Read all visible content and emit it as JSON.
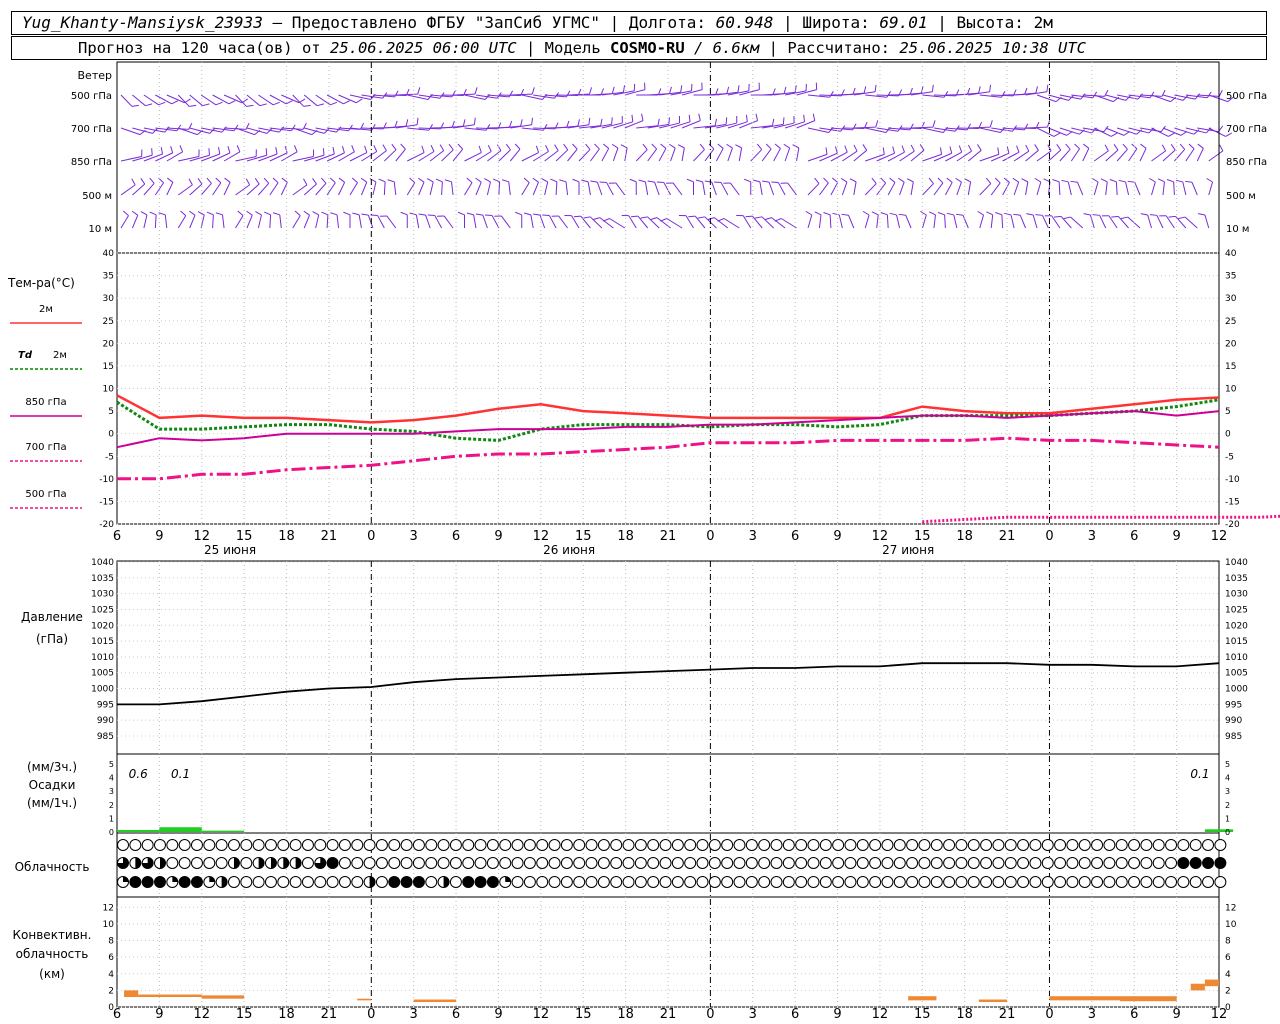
{
  "header": {
    "line1": {
      "station": "Yug_Khanty-Mansiysk_23933",
      "provider": "— Предоставлено ФГБУ \"ЗапСиб УГМС\"",
      "lon_label": "Долгота:",
      "lon_value": "60.948",
      "lat_label": "Широта:",
      "lat_value": "69.01",
      "alt_label": "Высота: 2м",
      "sep": "|"
    },
    "line2": {
      "forecast_label": "Прогноз на 120 часа(ов) от",
      "forecast_time": "25.06.2025 06:00 UTC",
      "model_label": "Модель",
      "model_name": "COSMO-RU",
      "model_res": "/ 6.6км",
      "calc_label": "Рассчитано:",
      "calc_time": "25.06.2025 10:38 UTC",
      "sep": "|"
    }
  },
  "wind_panel": {
    "title": "Ветер",
    "levels": [
      "500 гПа",
      "700 гПа",
      "850 гПа",
      "500 м",
      "10 м"
    ]
  },
  "temp_panel": {
    "title": "Тем-ра(°C)",
    "legend": [
      {
        "label": "2м",
        "color": "#ff3333"
      },
      {
        "label_italic": "Td",
        "label": "2м",
        "color": "#008800"
      },
      {
        "label": "850 гПа",
        "color": "#cc0099"
      },
      {
        "label": "700 гПа",
        "color": "#ee1188"
      },
      {
        "label": "500 гПа",
        "color": "#ee1188"
      }
    ],
    "yticks": [
      40,
      35,
      30,
      25,
      20,
      15,
      10,
      5,
      0,
      -5,
      -10,
      -15,
      -20
    ]
  },
  "pressure_panel": {
    "title": "Давление",
    "unit": "(гПа)",
    "yticks": [
      1040,
      1035,
      1030,
      1025,
      1020,
      1015,
      1010,
      1005,
      1000,
      995,
      990,
      985
    ]
  },
  "precip_panel": {
    "unit3": "(мм/3ч.)",
    "title": "Осадки",
    "unit1": "(мм/1ч.)",
    "yticks": [
      5,
      4,
      3,
      2,
      1,
      0
    ],
    "annotations": [
      "0.6",
      "0.1",
      "0.1"
    ],
    "color": "#22cc22"
  },
  "cloud_panel": {
    "title": "Облачность"
  },
  "conv_panel": {
    "title1": "Конвективн.",
    "title2": "облачность",
    "unit": "(км)",
    "yticks": [
      12,
      10,
      8,
      6,
      4,
      2,
      0
    ],
    "color": "#ee8833"
  },
  "x_axis": {
    "hour_labels": [
      "6",
      "9",
      "12",
      "15",
      "18",
      "21",
      "0",
      "3",
      "6",
      "9",
      "12",
      "15",
      "18",
      "21",
      "0",
      "3",
      "6",
      "9",
      "12",
      "15",
      "18",
      "21",
      "0",
      "3",
      "6",
      "9",
      "12"
    ],
    "day_labels": [
      "25 июня",
      "26 июня",
      "27 июня"
    ]
  },
  "chart_data": {
    "type": "line",
    "x_hours": [
      0,
      3,
      6,
      9,
      12,
      15,
      18,
      21,
      24,
      27,
      30,
      33,
      36,
      39,
      42,
      45,
      48,
      51,
      54,
      57,
      60,
      63,
      66,
      69,
      72,
      75,
      78
    ],
    "temperature": {
      "ylim": [
        -20,
        40
      ],
      "series": [
        {
          "name": "2м",
          "values": [
            8.5,
            3.5,
            4,
            3.5,
            3.5,
            3,
            2.5,
            3,
            4,
            5.5,
            6.5,
            5,
            4.5,
            4,
            3.5,
            3.5,
            3.5,
            3.5,
            3.5,
            6,
            5,
            4.5,
            4.5,
            5.5,
            6.5,
            7.5,
            8
          ]
        },
        {
          "name": "Td 2м",
          "values": [
            7,
            1,
            1,
            1.5,
            2,
            2,
            1,
            0.5,
            -1,
            -1.5,
            1,
            2,
            2,
            2,
            1.5,
            2,
            2,
            1.5,
            2,
            4,
            4,
            4,
            4,
            4.5,
            5,
            6,
            7.5
          ]
        },
        {
          "name": "850 гПа",
          "values": [
            -3,
            -1,
            -1.5,
            -1,
            0,
            0,
            0,
            0,
            0.5,
            1,
            1,
            1,
            1.5,
            1.5,
            2,
            2,
            2.5,
            3,
            3.5,
            4,
            4,
            3.5,
            4,
            4.5,
            5,
            4,
            5
          ]
        },
        {
          "name": "700 гПа",
          "values": [
            -10,
            -10,
            -9,
            -9,
            -8,
            -7.5,
            -7,
            -6,
            -5,
            -4.5,
            -4.5,
            -4,
            -3.5,
            -3,
            -2,
            -2,
            -2,
            -1.5,
            -1.5,
            -1.5,
            -1.5,
            -1,
            -1.5,
            -1.5,
            -2,
            -2.5,
            -3
          ]
        },
        {
          "name": "500 гПа",
          "x_start": 57,
          "values": [
            -19.5,
            -19,
            -18.5,
            -18.5,
            -18.5,
            -18.5,
            -18.5,
            -18.5,
            -18.5,
            -18,
            -18,
            -18.5,
            -19,
            -19,
            -19.5
          ]
        }
      ]
    },
    "pressure": {
      "ylim": [
        985,
        1040
      ],
      "values": [
        995,
        995,
        996,
        997.5,
        999,
        1000,
        1000.5,
        1002,
        1003,
        1003.5,
        1004,
        1004.5,
        1005,
        1005.5,
        1006,
        1006.5,
        1006.5,
        1007,
        1007,
        1008,
        1008,
        1008,
        1007.5,
        1007.5,
        1007,
        1007,
        1008
      ]
    },
    "precipitation": {
      "ylim": [
        0,
        5
      ],
      "bars": [
        {
          "x": 0,
          "w": 3,
          "v": 0.15
        },
        {
          "x": 3,
          "w": 3,
          "v": 0.35
        },
        {
          "x": 6,
          "w": 3,
          "v": 0.1
        },
        {
          "x": 77,
          "w": 2,
          "v": 0.2
        }
      ]
    },
    "cloud_rows": {
      "row1": [
        0,
        0,
        0,
        0,
        0,
        0,
        0,
        0,
        0,
        0,
        0,
        0,
        0,
        0,
        0,
        0,
        0,
        0,
        0,
        0,
        0,
        0,
        0,
        0,
        0,
        0,
        0,
        0,
        0,
        0,
        0,
        0,
        0,
        0,
        0,
        0,
        0,
        0,
        0,
        0,
        0,
        0,
        0,
        0,
        0,
        0,
        0,
        0,
        0,
        0,
        0,
        0,
        0,
        0,
        0,
        0,
        0,
        0,
        0,
        0,
        0,
        0,
        0,
        0,
        0,
        0,
        0,
        0,
        0,
        0,
        0,
        0,
        0,
        0,
        0,
        0,
        0,
        0,
        0,
        0,
        0,
        0,
        0,
        0,
        0,
        0,
        0,
        0,
        0,
        0
      ],
      "row2": [
        3,
        2,
        3,
        2,
        0,
        0,
        0,
        0,
        0,
        2,
        0,
        2,
        2,
        2,
        2,
        0,
        3,
        4,
        0,
        0,
        0,
        0,
        0,
        0,
        0,
        0,
        0,
        0,
        0,
        0,
        0,
        0,
        0,
        0,
        0,
        0,
        0,
        0,
        0,
        0,
        0,
        0,
        0,
        0,
        0,
        0,
        0,
        0,
        0,
        0,
        0,
        0,
        0,
        0,
        0,
        0,
        0,
        0,
        0,
        0,
        0,
        0,
        0,
        0,
        0,
        0,
        0,
        0,
        0,
        0,
        0,
        0,
        0,
        0,
        0,
        0,
        0,
        0,
        0,
        0,
        0,
        0,
        0,
        0,
        0,
        0,
        4,
        4,
        4,
        4
      ],
      "row3": [
        1,
        4,
        4,
        4,
        1,
        4,
        4,
        1,
        2,
        0,
        0,
        0,
        0,
        0,
        0,
        0,
        0,
        0,
        0,
        0,
        2,
        0,
        4,
        4,
        4,
        0,
        2,
        0,
        4,
        4,
        4,
        1,
        0,
        0,
        0,
        0,
        0,
        0,
        0,
        0,
        0,
        0,
        0,
        0,
        0,
        0,
        0,
        0,
        0,
        0,
        0,
        0,
        0,
        0,
        0,
        0,
        0,
        0,
        0,
        0,
        0,
        0,
        0,
        0,
        0,
        0,
        0,
        0,
        0,
        0,
        0,
        0,
        0,
        0,
        0,
        0,
        0,
        0,
        0,
        0,
        0,
        0,
        0,
        0,
        0,
        0,
        0,
        0,
        0,
        0
      ]
    },
    "convective": {
      "ylim": [
        0,
        13
      ],
      "bars": [
        {
          "x0": 0.5,
          "x1": 1.5,
          "bottom": 1.2,
          "top": 2.0
        },
        {
          "x0": 1.5,
          "x1": 6,
          "bottom": 1.2,
          "top": 1.5
        },
        {
          "x0": 6,
          "x1": 9,
          "bottom": 1.0,
          "top": 1.4
        },
        {
          "x0": 17,
          "x1": 18,
          "bottom": 0.8,
          "top": 1.0
        },
        {
          "x0": 21,
          "x1": 24,
          "bottom": 0.6,
          "top": 0.9
        },
        {
          "x0": 56,
          "x1": 58,
          "bottom": 0.8,
          "top": 1.3
        },
        {
          "x0": 61,
          "x1": 63,
          "bottom": 0.6,
          "top": 0.9
        },
        {
          "x0": 66,
          "x1": 75,
          "bottom": 0.8,
          "top": 1.3
        },
        {
          "x0": 71,
          "x1": 75,
          "bottom": 0.7,
          "top": 1.0
        },
        {
          "x0": 76,
          "x1": 77,
          "bottom": 2.0,
          "top": 2.8
        },
        {
          "x0": 77,
          "x1": 78,
          "bottom": 2.5,
          "top": 3.3
        }
      ]
    }
  }
}
